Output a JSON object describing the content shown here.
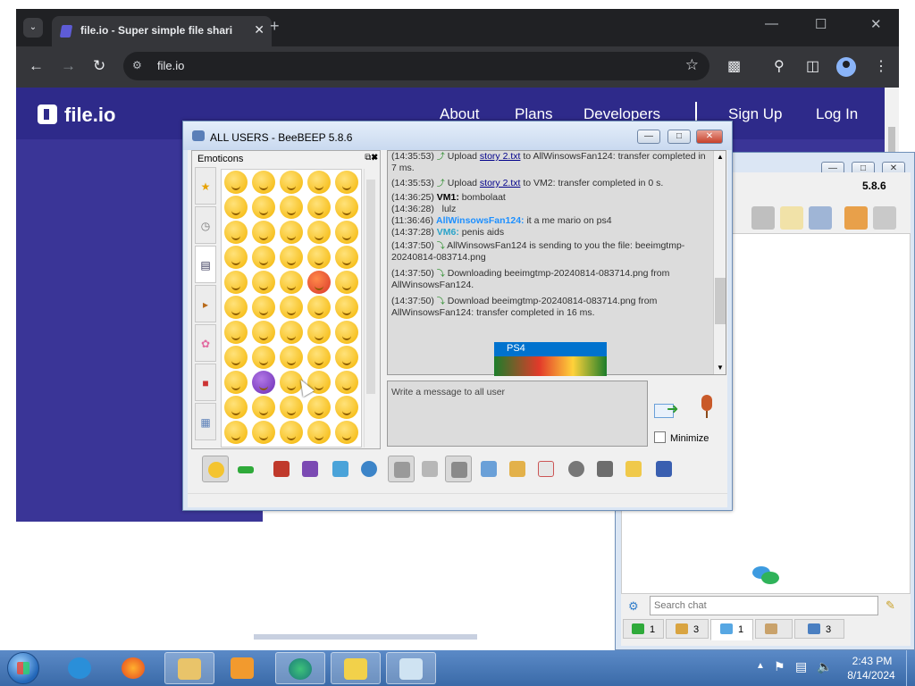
{
  "browser": {
    "tab_title": "file.io - Super simple file sharin",
    "url": "file.io",
    "tab_close": "✕",
    "new_tab": "+",
    "tab_menu": "⌄",
    "window_controls": [
      "—",
      "☐",
      "✕"
    ]
  },
  "site": {
    "logo_text": "file.io",
    "nav": [
      "About",
      "Plans",
      "Developers",
      "Sign Up",
      "Log In"
    ],
    "colors": {
      "hero": "#3a3597",
      "header": "#2e2a8a"
    }
  },
  "beebeep_main": {
    "title": "ALL USERS - BeeBEEP 5.8.6",
    "emoticons_label": "Emoticons",
    "messages": [
      {
        "time": "(14:35:53)",
        "pre": " Upload ",
        "link": "story 2.txt",
        "post": " to AllWinsowsFan124: transfer completed in 7 ms."
      },
      {
        "time": "(14:35:53)",
        "pre": " Upload ",
        "link": "story 2.txt",
        "post": " to VM2: transfer completed in 0 s."
      },
      {
        "time": "(14:36:25)",
        "nick": "VM1:",
        "text": " bombolaat"
      },
      {
        "time": "(14:36:28)",
        "text": "   lulz"
      },
      {
        "time": "(11:36:46)",
        "nick": "AllWinsowsFan124:",
        "text": " it a me mario on ps4"
      },
      {
        "time": "(14:37:28)",
        "nick": "VM6:",
        "text": " penis aids"
      },
      {
        "time": "(14:37:50)",
        "text": " AllWinsowsFan124 is sending to you the file: beeimgtmp-20240814-083714.png"
      },
      {
        "time": "(14:37:50)",
        "text": " Downloading beeimgtmp-20240814-083714.png from AllWinsowsFan124."
      },
      {
        "time": "(14:37:50)",
        "text": " Download beeimgtmp-20240814-083714.png from AllWinsowsFan124: transfer completed in 16 ms."
      }
    ],
    "image_label": "PS4",
    "input_placeholder": "Write a message to all user",
    "minimize_label": "Minimize"
  },
  "beebeep_side": {
    "version": "5.8.6",
    "search_placeholder": "Search chat",
    "tabs": [
      {
        "count": "1",
        "icon": "green-screen-icon"
      },
      {
        "count": "3",
        "icon": "group-icon"
      },
      {
        "count": "1",
        "icon": "chat-icon"
      },
      {
        "count": "",
        "icon": "users-icon"
      },
      {
        "count": "3",
        "icon": "pin-icon"
      }
    ]
  },
  "taskbar": {
    "time": "2:43 PM",
    "date": "8/14/2024"
  }
}
